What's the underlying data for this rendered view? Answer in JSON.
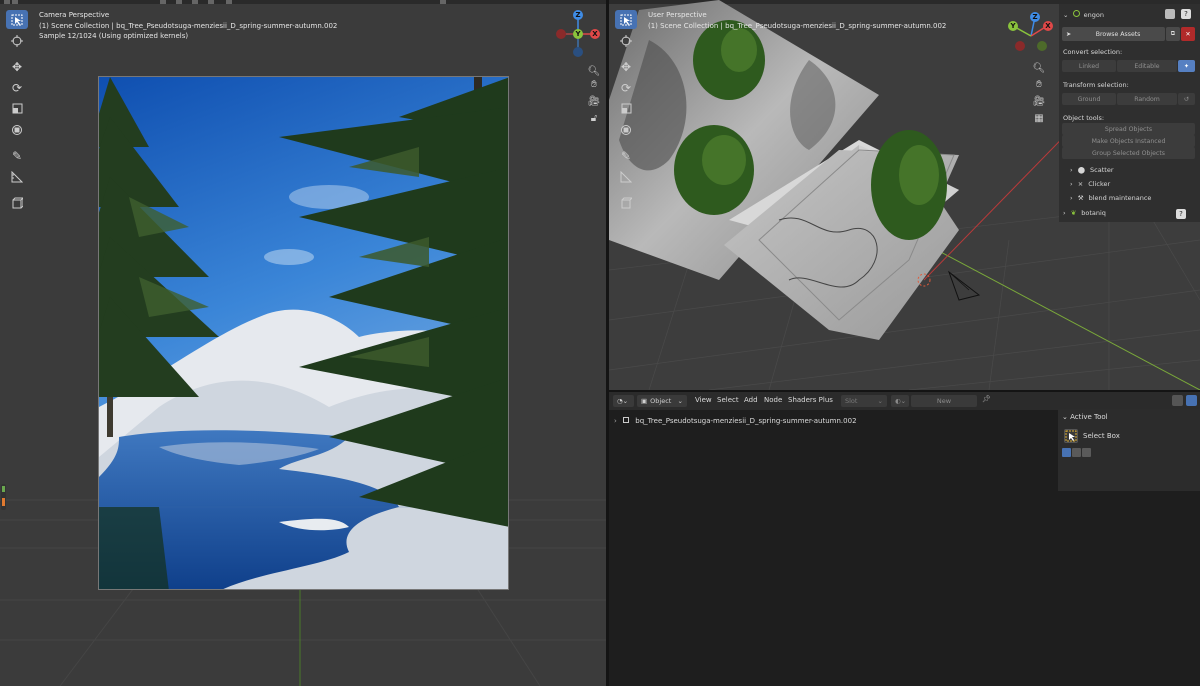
{
  "left_viewport": {
    "perspective_label": "Camera Perspective",
    "collection_label": "(1) Scene Collection | bq_Tree_Pseudotsuga-menziesii_D_spring-summer-autumn.002",
    "sample_label": "Sample 12/1024 (Using optimized kernels)"
  },
  "right_viewport": {
    "perspective_label": "User Perspective",
    "collection_label": "(1) Scene Collection | bq_Tree_Pseudotsuga-menziesii_D_spring-summer-autumn.002"
  },
  "gizmo": {
    "x": "X",
    "y": "Y",
    "z": "Z"
  },
  "npanel": {
    "addon_name": "engon",
    "browse_assets": "Browse Assets",
    "convert_selection": "Convert selection:",
    "linked": "Linked",
    "editable": "Editable",
    "transform_selection": "Transform selection:",
    "ground": "Ground",
    "random": "Random",
    "object_tools": "Object tools:",
    "spread_objects": "Spread Objects",
    "make_objects_instanced": "Make Objects Instanced",
    "group_selected_objects": "Group Selected Objects",
    "scatter": "Scatter",
    "clicker": "Clicker",
    "blend_maintenance": "blend maintenance",
    "botaniq": "botaniq"
  },
  "shader_editor": {
    "mode": "Object",
    "menus": [
      "View",
      "Select",
      "Add",
      "Node",
      "Shaders Plus"
    ],
    "slot": "Slot",
    "new_button": "New",
    "breadcrumb": "bq_Tree_Pseudotsuga-menziesii_D_spring-summer-autumn.002",
    "active_tool_title": "Active Tool",
    "active_tool_name": "Select Box"
  },
  "colors": {
    "accent": "#4772b3",
    "x_axis": "#e04848",
    "y_axis": "#8ac43c",
    "z_axis": "#3f8ce6",
    "close_button": "#b12a2a"
  }
}
